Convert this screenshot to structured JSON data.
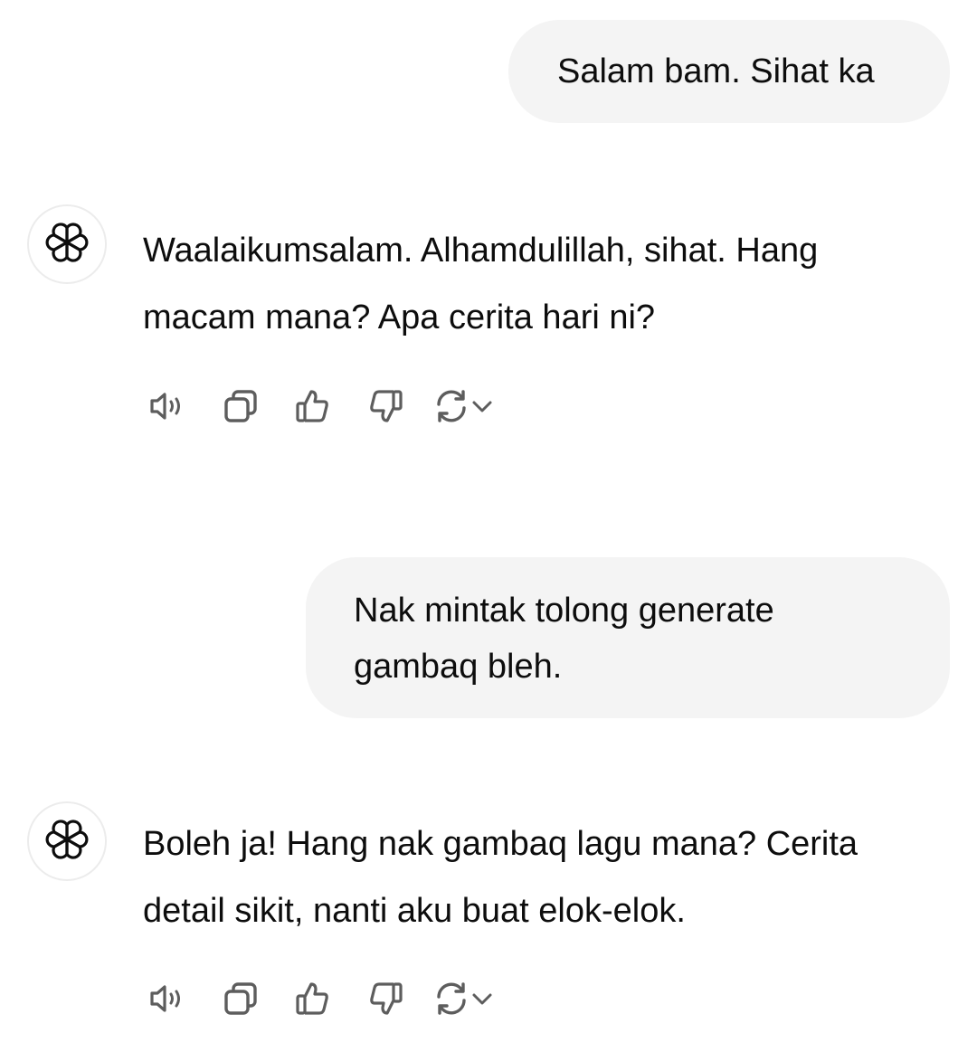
{
  "conversation": {
    "messages": [
      {
        "role": "user",
        "text": "Salam bam. Sihat ka"
      },
      {
        "role": "assistant",
        "text": "Waalaikumsalam. Alhamdulillah, sihat. Hang macam mana? Apa cerita hari ni?",
        "avatar_icon": "openai-logo-icon"
      },
      {
        "role": "user",
        "text": "Nak mintak tolong generate gambaq bleh."
      },
      {
        "role": "assistant",
        "text": "Boleh ja! Hang nak gambaq lagu mana? Cerita detail sikit, nanti aku buat elok-elok.",
        "avatar_icon": "openai-logo-icon"
      }
    ]
  },
  "message_actions": {
    "icons": [
      "speaker-icon",
      "copy-icon",
      "thumbs-up-icon",
      "thumbs-down-icon",
      "regenerate-icon",
      "chevron-down-icon"
    ]
  },
  "colors": {
    "user_bubble": "#f4f4f4",
    "text": "#0d0d0d",
    "icon": "#5d5d5d"
  }
}
